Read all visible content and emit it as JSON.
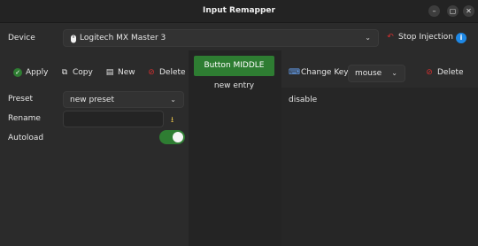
{
  "window": {
    "title": "Input Remapper",
    "controls": [
      "minimize-icon",
      "maximize-icon",
      "close-icon"
    ]
  },
  "device_row": {
    "label": "Device",
    "device_icon": "mouse-icon",
    "device_name": "Logitech MX Master 3",
    "stop_injection_label": "Stop Injection",
    "info_icon": "info-icon"
  },
  "toolbar": {
    "apply_label": "Apply",
    "copy_label": "Copy",
    "new_label": "New",
    "delete_label": "Delete"
  },
  "preset": {
    "label": "Preset",
    "selected": "new preset"
  },
  "rename": {
    "label": "Rename",
    "value": ""
  },
  "autoload": {
    "label": "Autoload",
    "enabled": true
  },
  "mappings": {
    "items": [
      "Button MIDDLE",
      "new entry"
    ]
  },
  "mapping_editor": {
    "change_key_label": "Change Key",
    "type_selected": "mouse",
    "delete_label": "Delete",
    "output_text": "disable"
  },
  "colors": {
    "accent_green": "#2e7d32",
    "delete_red": "#d32f2f",
    "info_blue": "#1e88e5"
  }
}
